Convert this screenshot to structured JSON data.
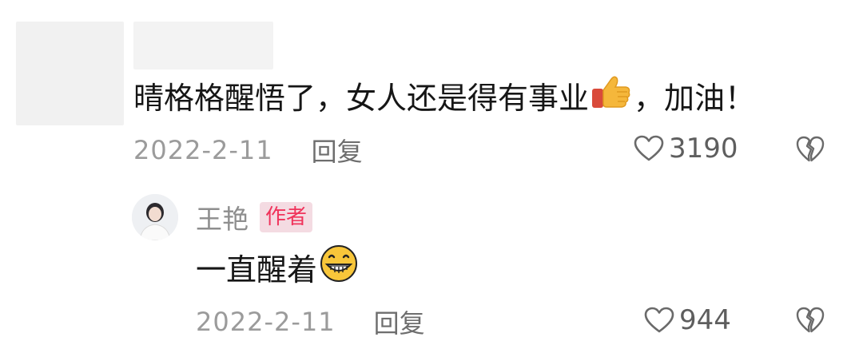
{
  "comment": {
    "text_part1": "晴格格醒悟了，女人还是得有事业",
    "text_part2": "，加油！",
    "date": "2022-2-11",
    "reply_label": "回复",
    "likes": "3190",
    "icons": {
      "emoji": "thumbs-up-emoji",
      "like": "heart-outline-icon",
      "dislike": "broken-heart-icon"
    }
  },
  "reply": {
    "author_name": "王艳",
    "author_badge": "作者",
    "text": "一直醒着",
    "date": "2022-2-11",
    "reply_label": "回复",
    "likes": "944",
    "icons": {
      "emoji": "grinning-emoji",
      "like": "heart-outline-icon",
      "dislike": "broken-heart-icon"
    }
  },
  "colors": {
    "text": "#161616",
    "meta": "#9b9b9b",
    "badge_text": "#f0335b",
    "badge_bg": "#f4dbe2"
  }
}
